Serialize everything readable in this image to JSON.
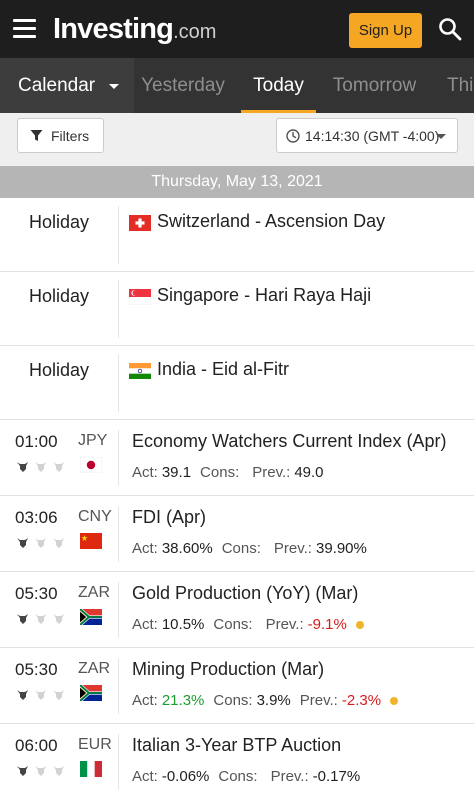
{
  "header": {
    "logo_main": "Investing",
    "logo_tld": ".com",
    "signup_label": "Sign Up",
    "icons": {
      "menu": "hamburger-icon",
      "search": "search-icon"
    },
    "accent_color": "#f5a623"
  },
  "nav": {
    "calendar_label": "Calendar",
    "tabs": [
      {
        "label": "Yesterday",
        "active": false
      },
      {
        "label": "Today",
        "active": true
      },
      {
        "label": "Tomorrow",
        "active": false
      },
      {
        "label": "This Week",
        "active": false
      }
    ]
  },
  "filters": {
    "filters_label": "Filters",
    "time_label": "14:14:30 (GMT -4:00)"
  },
  "date_header": "Thursday, May 13, 2021",
  "holidays": [
    {
      "label": "Holiday",
      "text": "Switzerland - Ascension Day",
      "flag": "switzerland"
    },
    {
      "label": "Holiday",
      "text": "Singapore - Hari Raya Haji",
      "flag": "singapore"
    },
    {
      "label": "Holiday",
      "text": "India - Eid al-Fitr",
      "flag": "india"
    }
  ],
  "events": [
    {
      "time": "01:00",
      "currency": "JPY",
      "flag": "japan",
      "importance": 1,
      "name": "Economy Watchers Current Index (Apr)",
      "act_label": "Act:",
      "act": "39.1",
      "act_color": "neutral",
      "cons_label": "Cons:",
      "cons": "",
      "prev_label": "Prev.:",
      "prev": "49.0",
      "prev_color": "neutral",
      "revised_dot": false
    },
    {
      "time": "03:06",
      "currency": "CNY",
      "flag": "china",
      "importance": 1,
      "name": "FDI (Apr)",
      "act_label": "Act:",
      "act": "38.60%",
      "act_color": "neutral",
      "cons_label": "Cons:",
      "cons": "",
      "prev_label": "Prev.:",
      "prev": "39.90%",
      "prev_color": "neutral",
      "revised_dot": false
    },
    {
      "time": "05:30",
      "currency": "ZAR",
      "flag": "south-africa",
      "importance": 1,
      "name": "Gold Production (YoY) (Mar)",
      "act_label": "Act:",
      "act": "10.5%",
      "act_color": "neutral",
      "cons_label": "Cons:",
      "cons": "",
      "prev_label": "Prev.:",
      "prev": "-9.1%",
      "prev_color": "red",
      "revised_dot": true
    },
    {
      "time": "05:30",
      "currency": "ZAR",
      "flag": "south-africa",
      "importance": 1,
      "name": "Mining Production (Mar)",
      "act_label": "Act:",
      "act": "21.3%",
      "act_color": "green",
      "cons_label": "Cons:",
      "cons": "3.9%",
      "prev_label": "Prev.:",
      "prev": "-2.3%",
      "prev_color": "red",
      "revised_dot": true
    },
    {
      "time": "06:00",
      "currency": "EUR",
      "flag": "italy",
      "importance": 1,
      "name": "Italian 3-Year BTP Auction",
      "act_label": "Act:",
      "act": "-0.06%",
      "act_color": "neutral",
      "cons_label": "Cons:",
      "cons": "",
      "prev_label": "Prev.:",
      "prev": "-0.17%",
      "prev_color": "neutral",
      "revised_dot": false
    }
  ]
}
